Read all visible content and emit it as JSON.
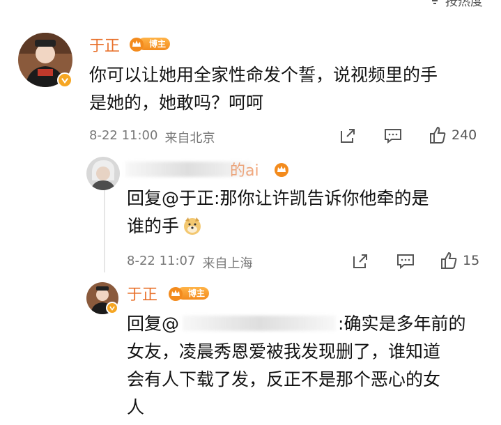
{
  "sort": {
    "label": "按热度"
  },
  "comments": [
    {
      "name": "于正",
      "badge": "博主",
      "text_lines": [
        "你可以让她用全家性命发个誓，说视频里的手",
        "是她的，她敢吗？呵呵"
      ],
      "time": "8-22 11:00",
      "location": "来自北京",
      "likes": "240"
    },
    {
      "name_visible": "的ai",
      "reply_prefix": "回复",
      "reply_to": "@于正",
      "text_lines": [
        ":那你让许凯告诉你他牵的是",
        "谁的手"
      ],
      "emoji": "doge-emoji",
      "time": "8-22 11:07",
      "location": "来自上海",
      "likes": "15"
    },
    {
      "name": "于正",
      "badge": "博主",
      "reply_prefix": "回复@",
      "text_lines": [
        ":确实是多年前的",
        "女友，凌晨秀恩爱被我发现删了，谁知道",
        "会有人下载了发，反正不是那个恶心的女",
        "人"
      ]
    }
  ],
  "colors": {
    "name": "#e8702a",
    "badge": "#f38b1d",
    "text": "#111111",
    "meta": "#777777"
  }
}
